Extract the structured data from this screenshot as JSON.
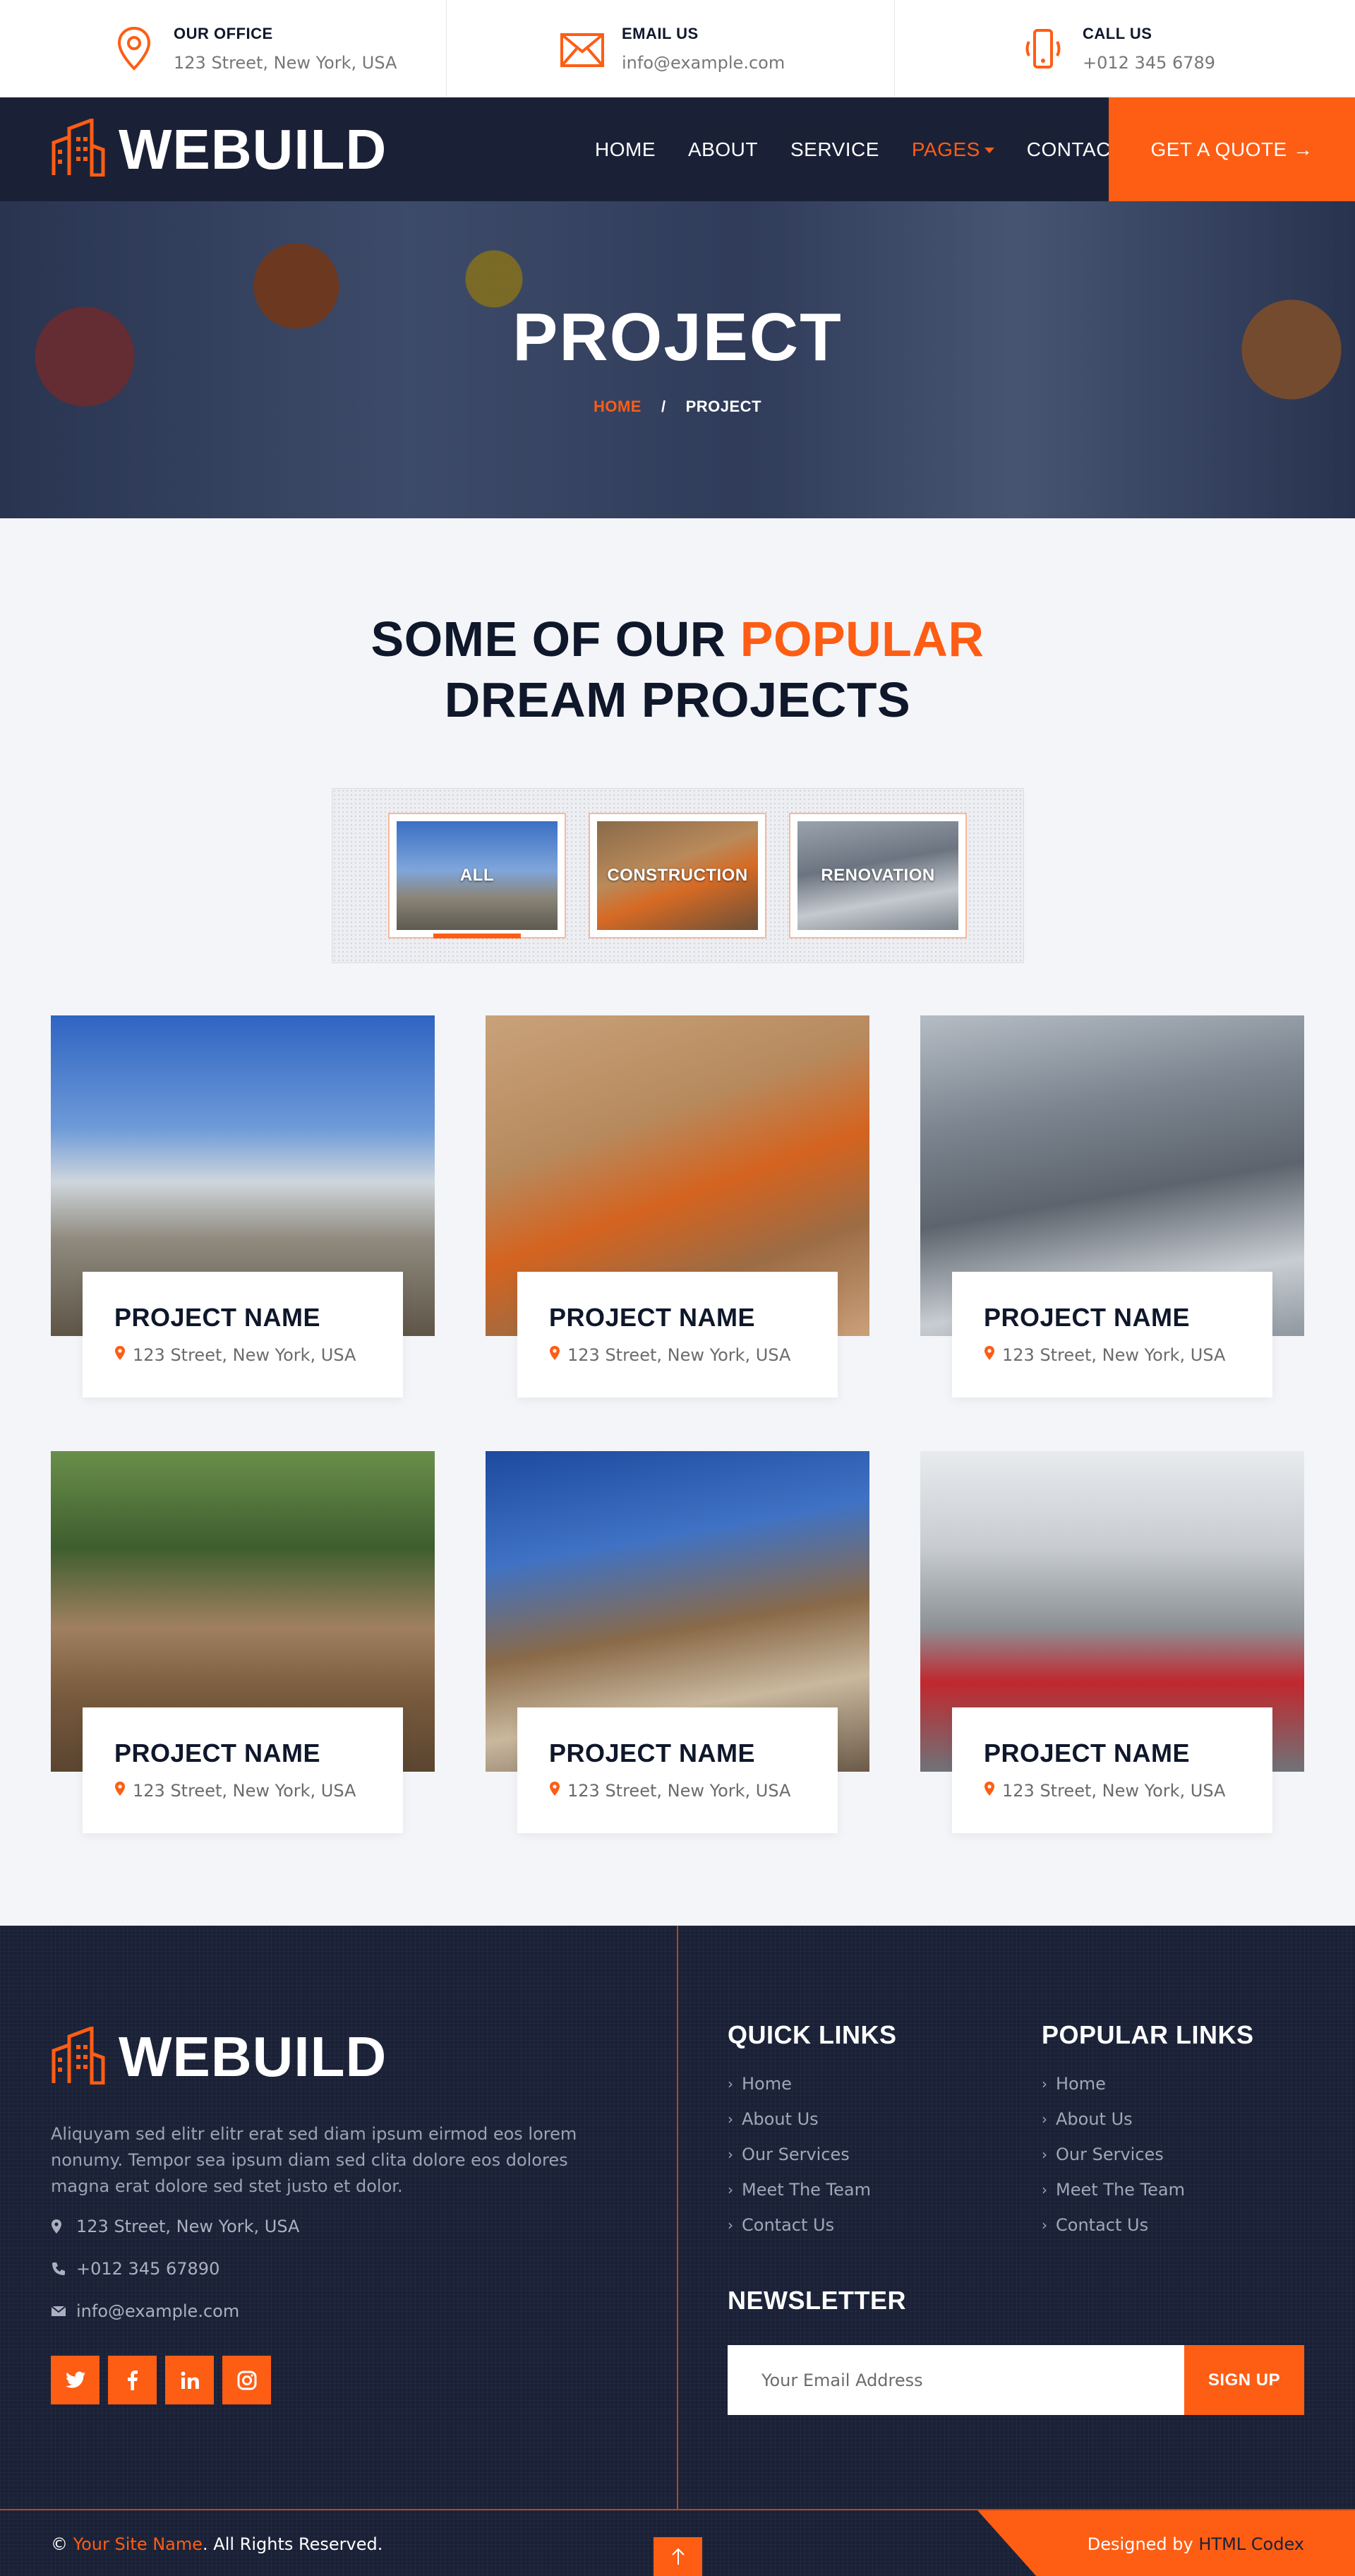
{
  "topbar": {
    "office": {
      "title": "OUR OFFICE",
      "value": "123 Street, New York, USA"
    },
    "email": {
      "title": "EMAIL US",
      "value": "info@example.com"
    },
    "call": {
      "title": "CALL US",
      "value": "+012 345 6789"
    }
  },
  "brand": {
    "name": "WEBUILD",
    "accent": "#fe5d14",
    "dark": "#1a2137"
  },
  "nav": {
    "items": [
      "HOME",
      "ABOUT",
      "SERVICE",
      "PAGES",
      "CONTACT"
    ],
    "active": "PAGES",
    "cta": "GET A QUOTE →"
  },
  "hero": {
    "title": "PROJECT",
    "crumb_home": "HOME",
    "crumb_sep": "/",
    "crumb_current": "PROJECT"
  },
  "section": {
    "title_pre": "SOME OF OUR ",
    "title_accent": "POPULAR",
    "title_post": "DREAM PROJECTS"
  },
  "filters": [
    "ALL",
    "CONSTRUCTION",
    "RENOVATION"
  ],
  "projects": [
    {
      "name": "PROJECT NAME",
      "address": "123 Street, New York, USA"
    },
    {
      "name": "PROJECT NAME",
      "address": "123 Street, New York, USA"
    },
    {
      "name": "PROJECT NAME",
      "address": "123 Street, New York, USA"
    },
    {
      "name": "PROJECT NAME",
      "address": "123 Street, New York, USA"
    },
    {
      "name": "PROJECT NAME",
      "address": "123 Street, New York, USA"
    },
    {
      "name": "PROJECT NAME",
      "address": "123 Street, New York, USA"
    }
  ],
  "footer": {
    "about": "Aliquyam sed elitr elitr erat sed diam ipsum eirmod eos lorem nonumy. Tempor sea ipsum diam sed clita dolore eos dolores magna erat dolore sed stet justo et dolor.",
    "address": "123 Street, New York, USA",
    "phone": "+012 345 67890",
    "email": "info@example.com",
    "quick_title": "QUICK LINKS",
    "quick_links": [
      "Home",
      "About Us",
      "Our Services",
      "Meet The Team",
      "Contact Us"
    ],
    "popular_title": "POPULAR LINKS",
    "popular_links": [
      "Home",
      "About Us",
      "Our Services",
      "Meet The Team",
      "Contact Us"
    ],
    "newsletter_title": "NEWSLETTER",
    "newsletter_placeholder": "Your Email Address",
    "newsletter_button": "SIGN UP",
    "copy_pre": "© ",
    "copy_site": "Your Site Name",
    "copy_post": ". All Rights Reserved.",
    "designed_pre": "Designed by ",
    "designed_by": "HTML Codex"
  }
}
